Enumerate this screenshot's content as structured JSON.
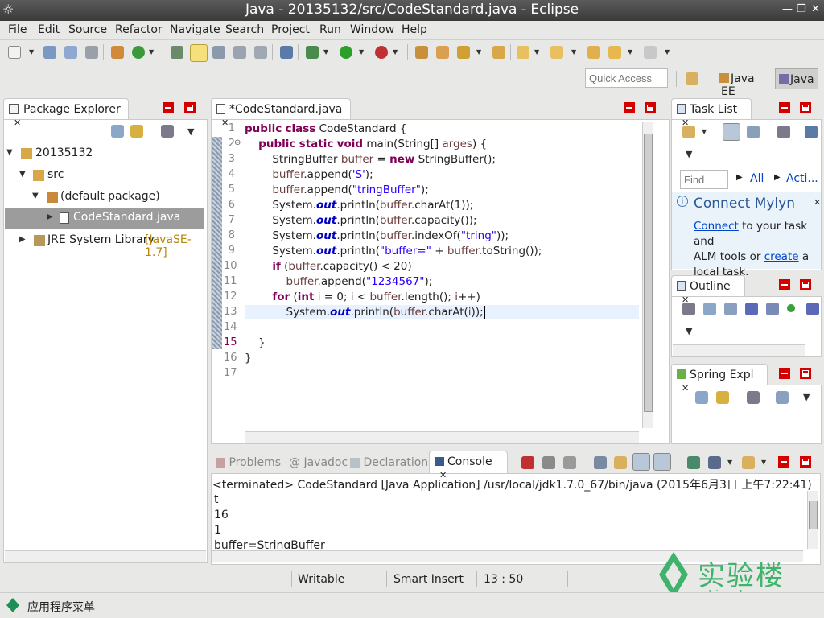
{
  "window": {
    "title": "Java - 20135132/src/CodeStandard.java - Eclipse",
    "btn_min": "—",
    "btn_restore": "❐",
    "btn_close": "✕"
  },
  "menu": [
    "File",
    "Edit",
    "Source",
    "Refactor",
    "Navigate",
    "Search",
    "Project",
    "Run",
    "Window",
    "Help"
  ],
  "quick_access": {
    "placeholder": "Quick Access"
  },
  "perspectives": [
    {
      "label": "Java EE"
    },
    {
      "label": "Java",
      "active": true
    }
  ],
  "package_explorer": {
    "tab": "Package Explorer",
    "tree": [
      {
        "label": "20135132",
        "level": 0,
        "expanded": true
      },
      {
        "label": "src",
        "level": 1,
        "expanded": true
      },
      {
        "label": "(default package)",
        "level": 2,
        "expanded": true
      },
      {
        "label": "CodeStandard.java",
        "level": 3,
        "selected": true
      },
      {
        "label": "JRE System Library",
        "suffix": "[JavaSE-1.7]",
        "level": 0,
        "expanded": false
      }
    ]
  },
  "editor": {
    "tab": "*CodeStandard.java",
    "line_numbers": [
      "1",
      "2",
      "3",
      "4",
      "5",
      "6",
      "7",
      "8",
      "9",
      "10",
      "11",
      "12",
      "13",
      "14",
      "15",
      "16",
      "17"
    ],
    "fold_marker": "⊖"
  },
  "task_list": {
    "tab": "Task List",
    "find_placeholder": "Find",
    "all": "All",
    "activate": "Acti...",
    "connect_title": "Connect Mylyn",
    "connect_link": "Connect",
    "connect_text1": " to your task and",
    "connect_text2": "ALM tools or ",
    "create_link": "create",
    "connect_text3": " a",
    "connect_text4": "local task."
  },
  "outline": {
    "tab": "Outline"
  },
  "spring": {
    "tab": "Spring Expl"
  },
  "bottom_tabs": [
    "Problems",
    "Javadoc",
    "Declaration",
    "Console"
  ],
  "console": {
    "header": "<terminated> CodeStandard [Java Application] /usr/local/jdk1.7.0_67/bin/java (2015年6月3日 上午7:22:41)",
    "lines": [
      "t",
      "16",
      "1",
      "buffer=StringBuffer"
    ]
  },
  "status": {
    "writable": "Writable",
    "insert_mode": "Smart Insert",
    "position": "13 : 50"
  },
  "watermark": {
    "brand_cn": "实验楼",
    "brand_url": "shiyanlou.com",
    "color": "#3fb36b"
  },
  "taskbar": {
    "label": "应用程序菜单"
  },
  "colors": {
    "keyword": "#7f0055",
    "string": "#2a00ff",
    "field": "#0000c0",
    "local_var": "#6a3e3e",
    "close_button": "#d40000"
  }
}
